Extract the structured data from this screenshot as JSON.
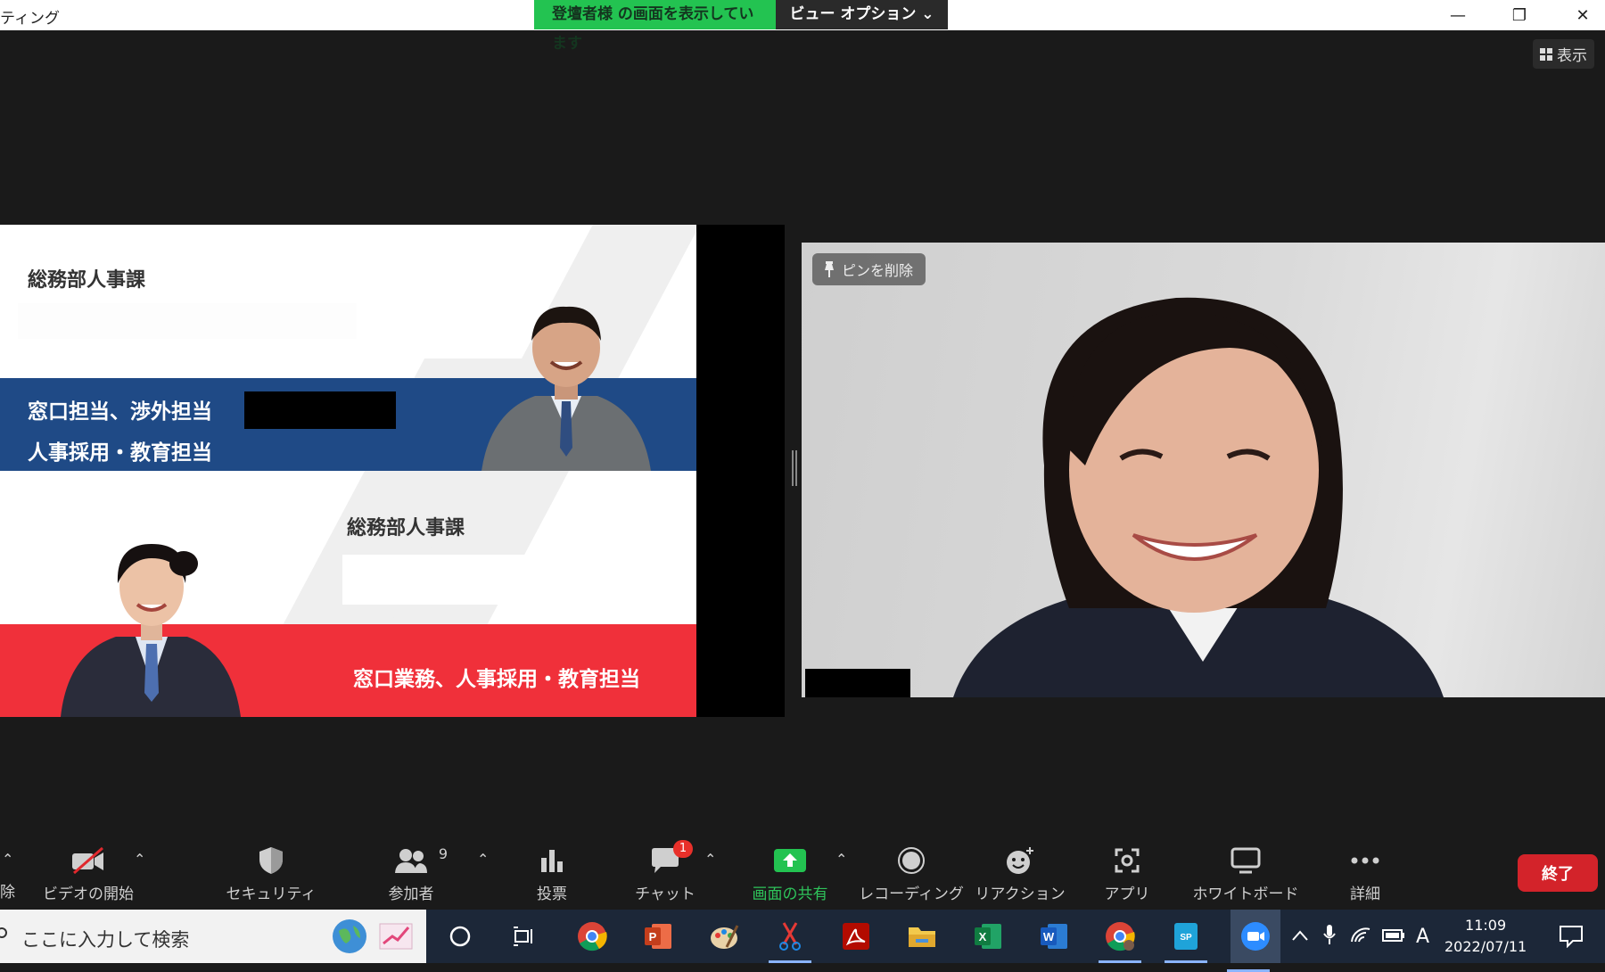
{
  "window": {
    "title": "ティング",
    "share_banner": "登壇者様 の画面を表示しています",
    "view_options": "ビュー オプション ⌄",
    "controls": {
      "minimize": "—",
      "restore": "❐",
      "close": "✕"
    }
  },
  "meeting": {
    "view_button": "表示",
    "pin_button": "ピンを削除"
  },
  "slide": {
    "dept_top": "総務部人事課",
    "role_top_line1": "窓口担当、渉外担当",
    "role_top_line2": "人事採用・教育担当",
    "dept_bottom": "総務部人事課",
    "role_bottom": "窓口業務、人事採用・教育担当"
  },
  "toolbar": {
    "items": [
      {
        "label": "ビデオの開始",
        "icon": "video-off-icon"
      },
      {
        "label": "セキュリティ",
        "icon": "shield-icon"
      },
      {
        "label": "参加者",
        "icon": "participants-icon",
        "count": "9"
      },
      {
        "label": "投票",
        "icon": "poll-icon"
      },
      {
        "label": "チャット",
        "icon": "chat-icon",
        "badge": "1"
      },
      {
        "label": "画面の共有",
        "icon": "share-screen-icon"
      },
      {
        "label": "レコーディング",
        "icon": "record-icon"
      },
      {
        "label": "リアクション",
        "icon": "reaction-icon"
      },
      {
        "label": "アプリ",
        "icon": "apps-icon"
      },
      {
        "label": "ホワイトボード",
        "icon": "whiteboard-icon"
      },
      {
        "label": "詳細",
        "icon": "more-icon"
      }
    ],
    "left_edge_label": "除",
    "end_button": "終了"
  },
  "colors": {
    "share_green": "#23c351",
    "end_red": "#d3232a",
    "slide_blue": "#1f4a86",
    "slide_red": "#f0303a",
    "taskbar_bg": "#1c2738"
  },
  "taskbar": {
    "search_placeholder": "ここに入力して検索",
    "apps": [
      "cortana-icon",
      "task-view-icon",
      "chrome-icon",
      "powerpoint-icon",
      "paint-icon",
      "snipping-icon",
      "acrobat-icon",
      "file-explorer-icon",
      "excel-icon",
      "word-icon",
      "chrome-profile-icon",
      "sharepoint-icon",
      "zoom-icon"
    ],
    "ime_indicator": "A",
    "time": "11:09",
    "date": "2022/07/11"
  }
}
